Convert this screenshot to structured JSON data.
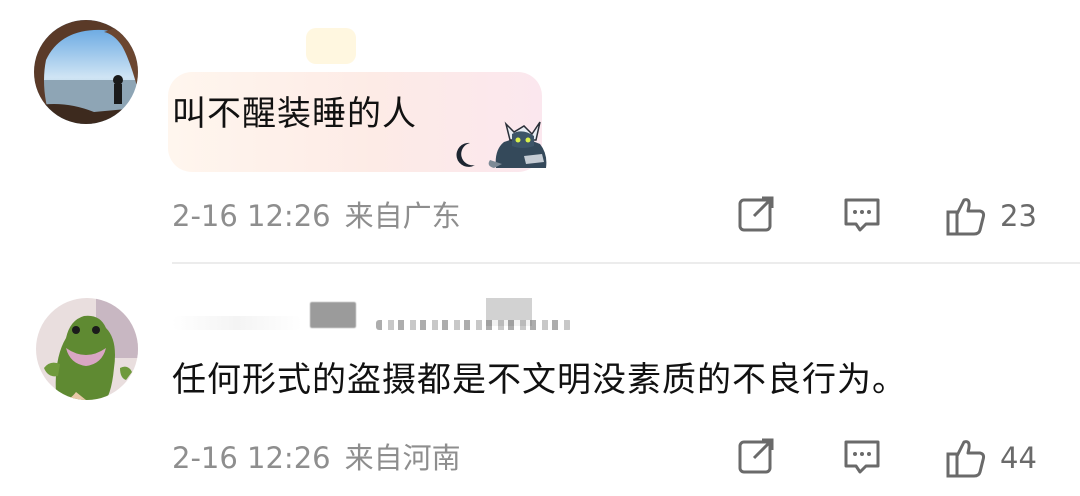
{
  "comments": [
    {
      "text": "叫不醒装睡的人",
      "time": "2-16 12:26",
      "location": "来自广东",
      "like_count": "23",
      "avatar_icon": "cave-sea-silhouette-avatar",
      "sticker_icon": "cat-mascot-sticker"
    },
    {
      "text": "任何形式的盗摄都是不文明没素质的不良行为。",
      "time": "2-16 12:26",
      "location": "来自河南",
      "like_count": "44",
      "avatar_icon": "green-plush-dinosaur-avatar"
    }
  ],
  "colors": {
    "text": "#111111",
    "meta": "#8e8e8e",
    "icon": "#6a6a6a",
    "divider": "#ececec"
  }
}
